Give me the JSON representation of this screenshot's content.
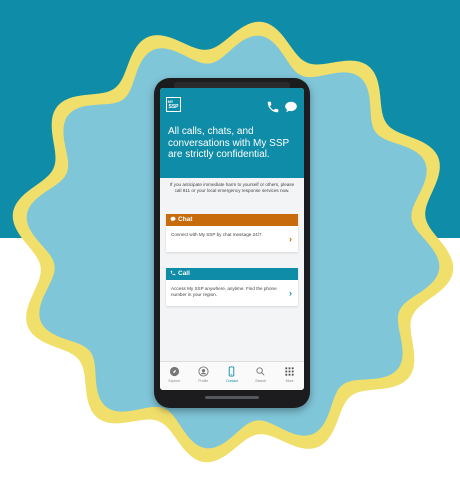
{
  "colors": {
    "teal_background": "#0f8da8",
    "badge_outline": "#f1df6b",
    "badge_fill": "#80c6d9",
    "chat_accent": "#c86b0d",
    "call_accent": "#0f8da8"
  },
  "app": {
    "logo": {
      "line1": "MY",
      "line2": "SSP"
    },
    "header_icons": [
      "phone-icon",
      "chat-bubble-icon"
    ],
    "headline": "All calls, chats, and conversations with My SSP are strictly confidential.",
    "disclaimer": "If you anticipate immediate harm to yourself or others, please call 911 or your local emergency response services now."
  },
  "cards": {
    "chat": {
      "title": "Chat",
      "icon": "chat-bubble-icon",
      "body": "Connect with My SSP by chat message 24/7.",
      "chevron": "›"
    },
    "call": {
      "title": "Call",
      "icon": "phone-icon",
      "body": "Access My SSP anywhere, anytime. Find the phone number in your region.",
      "chevron": "›"
    }
  },
  "nav": {
    "items": [
      {
        "label": "Explore",
        "icon": "compass-icon",
        "active": false
      },
      {
        "label": "Profile",
        "icon": "profile-icon",
        "active": false
      },
      {
        "label": "Contact",
        "icon": "phone-device-icon",
        "active": true
      },
      {
        "label": "Search",
        "icon": "search-icon",
        "active": false
      },
      {
        "label": "More",
        "icon": "grid-icon",
        "active": false
      }
    ]
  }
}
